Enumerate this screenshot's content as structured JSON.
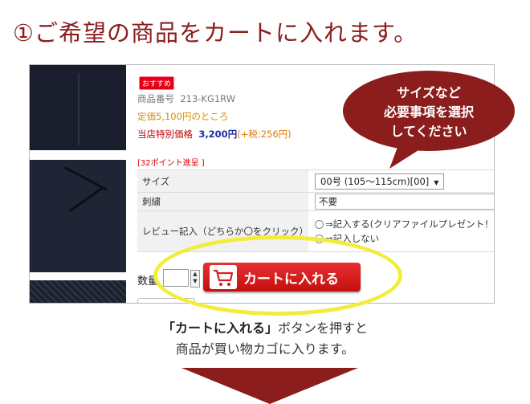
{
  "step_title": "①ご希望の商品をカートに入れます。",
  "product": {
    "badge": "おすすめ",
    "code_label": "商品番号",
    "code": "213-KG1RW",
    "list_price": "定価5,100円のところ",
    "sale_label": "当店特別価格",
    "sale_price": "3,200円",
    "tax": "(+税:256円)",
    "points": "[32ポイント進呈 ]"
  },
  "options": {
    "size_label": "サイズ",
    "size_value": "00号 (105～115cm)[00]",
    "embroidery_label": "刺繍",
    "embroidery_value": "不要",
    "review_label": "レビュー記入（どちらか〇をクリック）",
    "review_option1": "⇒記入する(クリアファイルプレゼント！)",
    "review_option2": "⇒記入しない"
  },
  "quantity_label": "数量",
  "cart_button_label": "カートに入れる",
  "bubble": {
    "line1": "サイズなど",
    "line2": "必要事項を選択",
    "line3": "してください"
  },
  "caption": {
    "highlight": "「カートに入れる」",
    "line1_rest": "ボタンを押すと",
    "line2": "商品が買い物カゴに入ります。"
  },
  "colors": {
    "title": "#8c1d1d",
    "bubble": "#8c1d1d",
    "cart_button": "#d81e1e",
    "highlight_ellipse": "#f2ed3a",
    "arrow": "#8c1d1d"
  },
  "icons": [
    "cart-icon",
    "chevron-down-icon",
    "spinner-icon",
    "down-arrow-icon"
  ]
}
